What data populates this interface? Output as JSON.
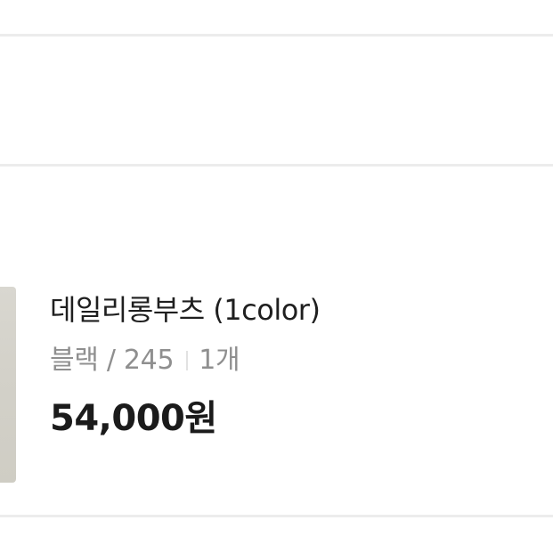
{
  "product": {
    "name": "데일리롱부츠 (1color)",
    "option": "블랙 / 245",
    "quantity": "1개",
    "price": "54,000원"
  }
}
